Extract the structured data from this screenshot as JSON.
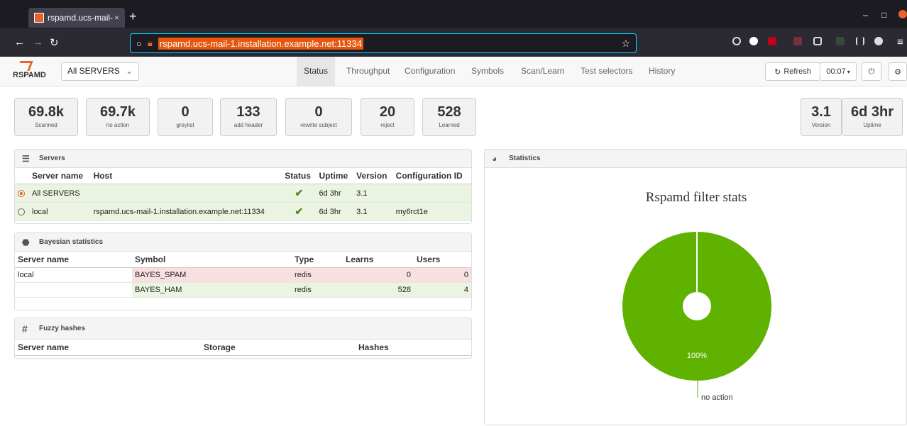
{
  "browser": {
    "tab_title": "rspamd.ucs-mail-",
    "tab_close": "×",
    "new_tab": "+",
    "url": "rspamd.ucs-mail-1.installation.example.net:11334"
  },
  "header": {
    "logo_text": "RSPAMD",
    "server_select": "All SERVERS",
    "tabs": [
      "Status",
      "Throughput",
      "Configuration",
      "Symbols",
      "Scan/Learn",
      "Test selectors",
      "History"
    ],
    "refresh_label": "Refresh",
    "refresh_interval": "00:07"
  },
  "stats": [
    {
      "value": "69.8k",
      "label": "Scanned"
    },
    {
      "value": "69.7k",
      "label": "no action"
    },
    {
      "value": "0",
      "label": "greylist"
    },
    {
      "value": "133",
      "label": "add header"
    },
    {
      "value": "0",
      "label": "rewrite subject"
    },
    {
      "value": "20",
      "label": "reject"
    },
    {
      "value": "528",
      "label": "Learned"
    }
  ],
  "right_stats": [
    {
      "value": "3.1",
      "label": "Version"
    },
    {
      "value": "6d 3hr",
      "label": "Uptime"
    }
  ],
  "servers": {
    "title": "Servers",
    "columns": [
      "Server name",
      "Host",
      "Status",
      "Uptime",
      "Version",
      "Configuration ID"
    ],
    "rows": [
      {
        "name": "All SERVERS",
        "host": "",
        "uptime": "6d 3hr",
        "version": "3.1",
        "config_id": ""
      },
      {
        "name": "local",
        "host": "rspamd.ucs-mail-1.installation.example.net:11334",
        "uptime": "6d 3hr",
        "version": "3.1",
        "config_id": "my6rct1e"
      }
    ]
  },
  "bayes": {
    "title": "Bayesian statistics",
    "columns": [
      "Server name",
      "Symbol",
      "Type",
      "Learns",
      "Users"
    ],
    "rows": [
      {
        "server": "local",
        "symbol": "BAYES_SPAM",
        "type": "redis",
        "learns": "0",
        "users": "0"
      },
      {
        "server": "",
        "symbol": "BAYES_HAM",
        "type": "redis",
        "learns": "528",
        "users": "4"
      }
    ]
  },
  "fuzzy": {
    "title": "Fuzzy hashes",
    "columns": [
      "Server name",
      "Storage",
      "Hashes"
    ]
  },
  "statistics": {
    "title": "Statistics"
  },
  "chart_data": {
    "type": "pie",
    "title": "Rspamd filter stats",
    "slices": [
      {
        "label": "no action",
        "value": 100,
        "display": "100%",
        "color": "#5fb300"
      }
    ]
  }
}
